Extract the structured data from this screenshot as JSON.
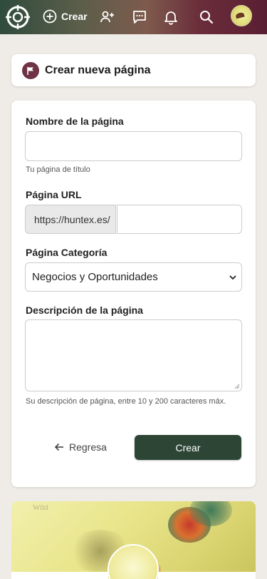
{
  "header": {
    "create_label": "Crear",
    "icons": [
      "logo-icon",
      "add-circle-icon",
      "add-user-icon",
      "chat-icon",
      "bell-icon",
      "search-icon",
      "avatar"
    ]
  },
  "title_card": {
    "title": "Crear nueva página"
  },
  "form": {
    "name_label": "Nombre de la página",
    "name_value": "",
    "name_hint": "Tu página de título",
    "url_label": "Página URL",
    "url_prefix": "https://huntex.es/",
    "url_value": "",
    "category_label": "Página Categoría",
    "category_selected": "Negocios y Oportunidades",
    "description_label": "Descripción de la página",
    "description_value": "",
    "description_hint": "Su descripción de página, entre 10 y 200 caracteres máx.",
    "back_label": "Regresa",
    "submit_label": "Crear"
  },
  "cover": {
    "word": "Wild"
  },
  "colors": {
    "primary_button": "#2c4535",
    "badge": "#6e3344",
    "page_bg": "#efebe6"
  }
}
